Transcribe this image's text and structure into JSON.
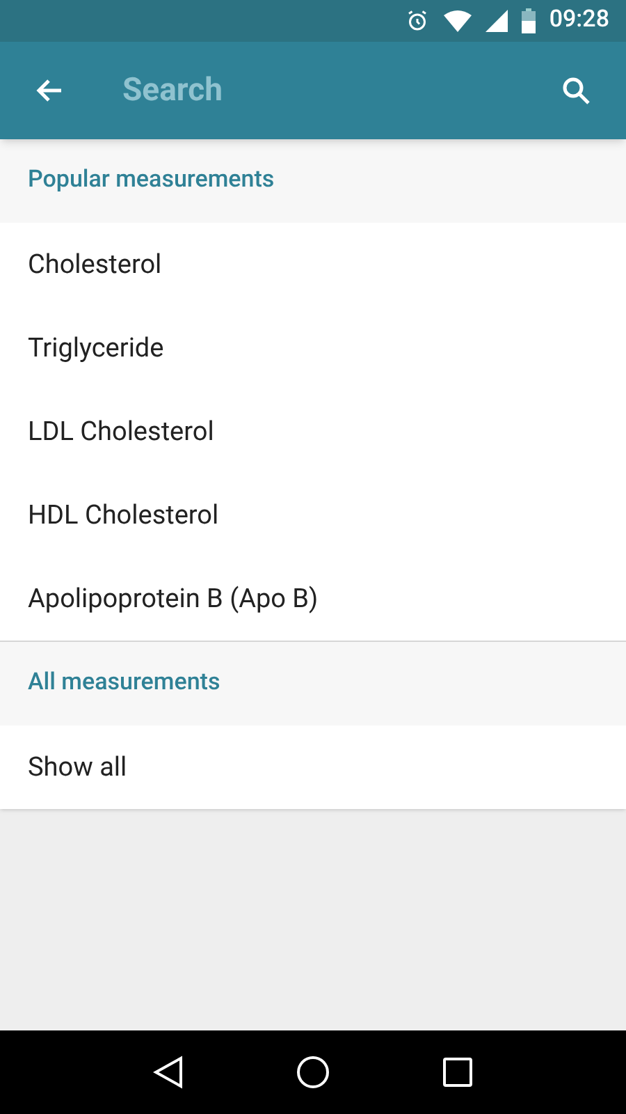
{
  "status_bar": {
    "time": "09:28"
  },
  "app_bar": {
    "search": {
      "placeholder": "Search"
    }
  },
  "sections": [
    {
      "title": "Popular measurements",
      "items": [
        "Cholesterol",
        "Triglyceride",
        "LDL Cholesterol",
        "HDL Cholesterol",
        "Apolipoprotein B (Apo B)"
      ]
    },
    {
      "title": "All measurements",
      "items": [
        "Show all"
      ]
    }
  ]
}
